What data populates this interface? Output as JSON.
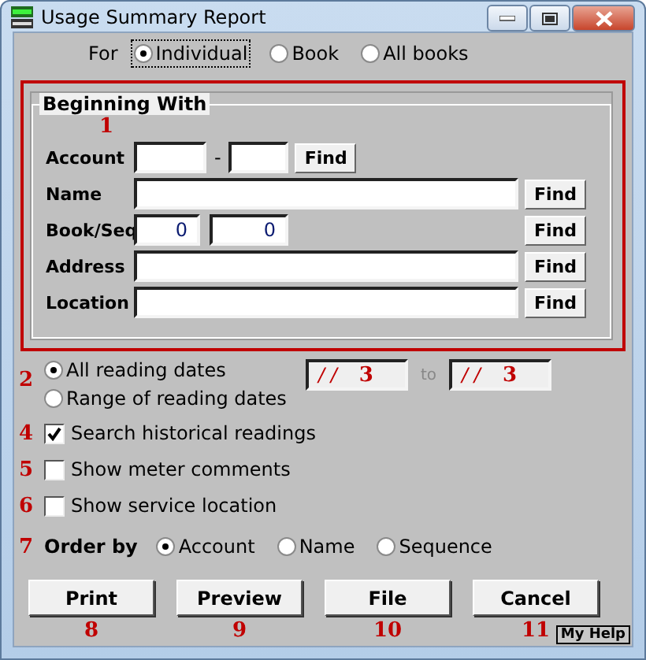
{
  "window": {
    "title": "Usage Summary Report"
  },
  "for_group": {
    "label": "For",
    "options": [
      {
        "label": "Individual",
        "selected": true
      },
      {
        "label": "Book",
        "selected": false
      },
      {
        "label": "All books",
        "selected": false
      }
    ]
  },
  "beginning_with": {
    "title": "Beginning With",
    "marker": "1",
    "rows": [
      {
        "kind": "split",
        "label": "Account",
        "separator": "-",
        "find": "Find"
      },
      {
        "kind": "wide",
        "label": "Name",
        "find": "Find"
      },
      {
        "kind": "pair",
        "label": "Book/Seq",
        "values": [
          "0",
          "0"
        ],
        "find": "Find"
      },
      {
        "kind": "wide",
        "label": "Address",
        "find": "Find"
      },
      {
        "kind": "wide",
        "label": "Location",
        "find": "Find"
      }
    ]
  },
  "dates": {
    "marker": "2",
    "options": [
      {
        "label": "All reading dates",
        "selected": true
      },
      {
        "label": "Range of reading dates",
        "selected": false
      }
    ],
    "from": {
      "value": "/ /",
      "marker": "3"
    },
    "to_label": "to",
    "to": {
      "value": "/ /",
      "marker": "3"
    }
  },
  "checkboxes": [
    {
      "marker": "4",
      "label": "Search historical readings",
      "checked": true
    },
    {
      "marker": "5",
      "label": "Show meter comments",
      "checked": false
    },
    {
      "marker": "6",
      "label": "Show service location",
      "checked": false
    }
  ],
  "order": {
    "marker": "7",
    "label": "Order by",
    "options": [
      {
        "label": "Account",
        "selected": true
      },
      {
        "label": "Name",
        "selected": false
      },
      {
        "label": "Sequence",
        "selected": false
      }
    ]
  },
  "buttons": [
    {
      "label": "Print",
      "marker": "8"
    },
    {
      "label": "Preview",
      "marker": "9"
    },
    {
      "label": "File",
      "marker": "10"
    },
    {
      "label": "Cancel",
      "marker": "11"
    }
  ],
  "help": "My Help"
}
